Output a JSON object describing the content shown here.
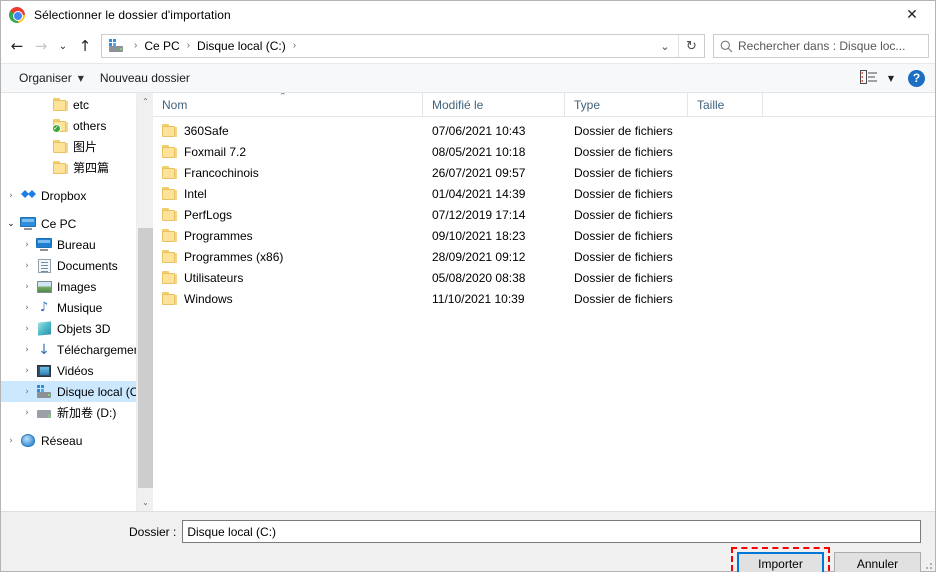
{
  "window": {
    "title": "Sélectionner le dossier d'importation",
    "app_icon": "chrome-icon",
    "close_label": "✕"
  },
  "nav": {
    "back": "←",
    "forward": "→",
    "recent": "⌄",
    "up": "↑",
    "dropdown": "⌄",
    "refresh": "↻",
    "breadcrumbs": [
      {
        "label": "Ce PC"
      },
      {
        "label": "Disque local (C:)"
      }
    ],
    "separator": "›",
    "search": {
      "icon": "search-icon",
      "text": "Rechercher dans : Disque loc..."
    }
  },
  "commandbar": {
    "organiser": "Organiser",
    "organiser_caret": "▼",
    "nouveau_dossier": "Nouveau dossier",
    "view_caret": "▼",
    "help": "?"
  },
  "tree": {
    "items": [
      {
        "label": "etc",
        "icon": "folder-icon",
        "indent": 2,
        "twisty": "",
        "selected": false
      },
      {
        "label": "others",
        "icon": "folder-sync-icon",
        "indent": 2,
        "twisty": "",
        "selected": false
      },
      {
        "label": "图片",
        "icon": "folder-icon",
        "indent": 2,
        "twisty": "",
        "selected": false
      },
      {
        "label": "第四篇",
        "icon": "folder-icon",
        "indent": 2,
        "twisty": "",
        "selected": false
      },
      {
        "label": "Dropbox",
        "icon": "dropbox-icon",
        "indent": 0,
        "twisty": "›",
        "selected": false,
        "group": true
      },
      {
        "label": "Ce PC",
        "icon": "monitor-icon",
        "indent": 0,
        "twisty": "⌄",
        "selected": false,
        "group": true,
        "open": true
      },
      {
        "label": "Bureau",
        "icon": "desktop-icon",
        "indent": 1,
        "twisty": "›",
        "selected": false
      },
      {
        "label": "Documents",
        "icon": "documents-icon",
        "indent": 1,
        "twisty": "›",
        "selected": false
      },
      {
        "label": "Images",
        "icon": "pictures-icon",
        "indent": 1,
        "twisty": "›",
        "selected": false
      },
      {
        "label": "Musique",
        "icon": "music-icon",
        "indent": 1,
        "twisty": "›",
        "selected": false
      },
      {
        "label": "Objets 3D",
        "icon": "objects3d-icon",
        "indent": 1,
        "twisty": "›",
        "selected": false
      },
      {
        "label": "Téléchargements",
        "icon": "downloads-icon",
        "indent": 1,
        "twisty": "›",
        "selected": false
      },
      {
        "label": "Vidéos",
        "icon": "videos-icon",
        "indent": 1,
        "twisty": "›",
        "selected": false
      },
      {
        "label": "Disque local (C:)",
        "icon": "drive-icon",
        "indent": 1,
        "twisty": "›",
        "selected": true
      },
      {
        "label": "新加卷 (D:)",
        "icon": "drive-plain-icon",
        "indent": 1,
        "twisty": "›",
        "selected": false
      },
      {
        "label": "Réseau",
        "icon": "network-icon",
        "indent": 0,
        "twisty": "›",
        "selected": false,
        "group": true
      }
    ],
    "scrollbar": {
      "up": "⌃",
      "down": "⌄"
    }
  },
  "filelist": {
    "columns": [
      {
        "key": "name",
        "label": "Nom"
      },
      {
        "key": "modified",
        "label": "Modifié le"
      },
      {
        "key": "type",
        "label": "Type"
      },
      {
        "key": "size",
        "label": "Taille"
      }
    ],
    "sort_indicator": "⌃",
    "rows": [
      {
        "name": "360Safe",
        "modified": "07/06/2021 10:43",
        "type": "Dossier de fichiers",
        "size": "",
        "icon": "folder-icon"
      },
      {
        "name": "Foxmail 7.2",
        "modified": "08/05/2021 10:18",
        "type": "Dossier de fichiers",
        "size": "",
        "icon": "folder-icon"
      },
      {
        "name": "Francochinois",
        "modified": "26/07/2021 09:57",
        "type": "Dossier de fichiers",
        "size": "",
        "icon": "folder-icon"
      },
      {
        "name": "Intel",
        "modified": "01/04/2021 14:39",
        "type": "Dossier de fichiers",
        "size": "",
        "icon": "folder-icon"
      },
      {
        "name": "PerfLogs",
        "modified": "07/12/2019 17:14",
        "type": "Dossier de fichiers",
        "size": "",
        "icon": "folder-icon"
      },
      {
        "name": "Programmes",
        "modified": "09/10/2021 18:23",
        "type": "Dossier de fichiers",
        "size": "",
        "icon": "folder-icon"
      },
      {
        "name": "Programmes (x86)",
        "modified": "28/09/2021 09:12",
        "type": "Dossier de fichiers",
        "size": "",
        "icon": "folder-icon"
      },
      {
        "name": "Utilisateurs",
        "modified": "05/08/2020 08:38",
        "type": "Dossier de fichiers",
        "size": "",
        "icon": "folder-icon"
      },
      {
        "name": "Windows",
        "modified": "11/10/2021 10:39",
        "type": "Dossier de fichiers",
        "size": "",
        "icon": "folder-icon"
      }
    ]
  },
  "footer": {
    "dossier_label": "Dossier :",
    "dossier_value": "Disque local (C:)",
    "import_button": "Importer",
    "cancel_button": "Annuler"
  },
  "colors": {
    "selection": "#cce8ff",
    "accent": "#0078d7",
    "annotation": "#ff0000",
    "header_text": "#41637d"
  }
}
